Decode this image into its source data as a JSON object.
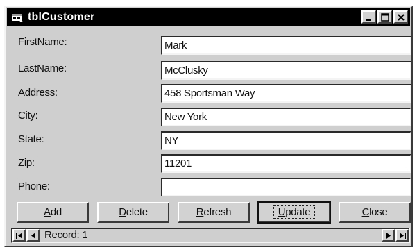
{
  "window": {
    "title": "tblCustomer",
    "icon": "form-icon"
  },
  "titlebar_buttons": {
    "minimize_icon": "minimize-icon",
    "maximize_icon": "maximize-icon",
    "close_icon": "close-icon"
  },
  "fields": [
    {
      "label": "FirstName:",
      "value": "Mark"
    },
    {
      "label": "LastName:",
      "value": "McClusky"
    },
    {
      "label": "Address:",
      "value": "458 Sportsman Way"
    },
    {
      "label": "City:",
      "value": "New York"
    },
    {
      "label": "State:",
      "value": "NY"
    },
    {
      "label": "Zip:",
      "value": "11201"
    },
    {
      "label": "Phone:",
      "value": ""
    }
  ],
  "buttons": {
    "add": {
      "accel": "A",
      "rest": "dd"
    },
    "delete": {
      "accel": "D",
      "rest": "elete"
    },
    "refresh": {
      "accel": "R",
      "rest": "efresh"
    },
    "update": {
      "accel": "U",
      "rest": "pdate"
    },
    "close": {
      "accel": "C",
      "rest": "lose"
    }
  },
  "record_navigator": {
    "caption": "Record: 1",
    "icons": [
      "first-record-icon",
      "previous-record-icon",
      "next-record-icon",
      "last-record-icon"
    ]
  }
}
